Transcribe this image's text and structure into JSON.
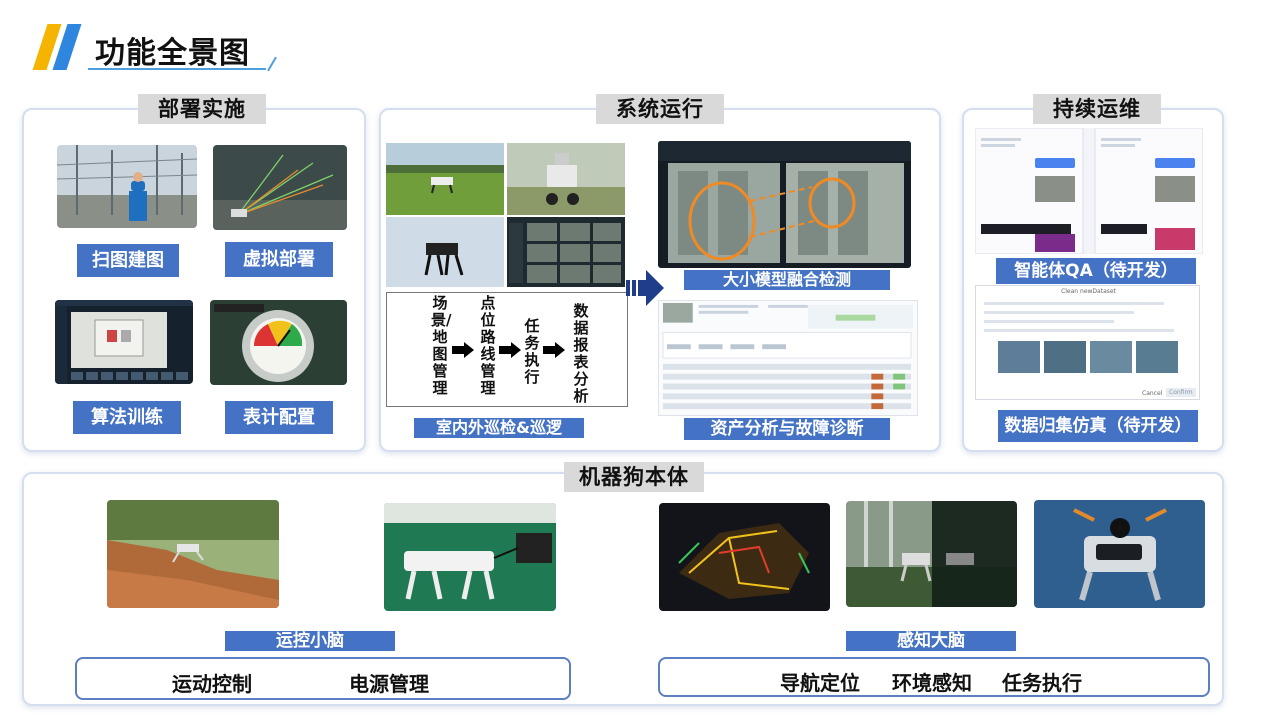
{
  "page": {
    "title": "功能全景图"
  },
  "colors": {
    "accent_blue": "#4472c4",
    "logo_yellow": "#f5b400",
    "logo_blue": "#2e86de"
  },
  "deploy": {
    "tag": "部署实施",
    "items": [
      "扫图建图",
      "虚拟部署",
      "算法训练",
      "表计配置"
    ]
  },
  "ops": {
    "tag": "系统运行",
    "process_steps": [
      "场景/地图管理",
      "点位路线管理",
      "任务执行",
      "数据报表分析"
    ],
    "patrol_label": "室内外巡检&巡逻",
    "model_label": "大小模型融合检测",
    "asset_label": "资产分析与故障诊断"
  },
  "maint": {
    "tag": "持续运维",
    "qa_label": "智能体QA（待开发）",
    "data_label": "数据归集仿真（待开发）",
    "dialog_title": "Clean newDataset",
    "dialog_cancel": "Cancel",
    "dialog_confirm": "Confirm"
  },
  "body": {
    "tag": "机器狗本体",
    "control_label": "运控小脑",
    "control_items": [
      "运动控制",
      "电源管理"
    ],
    "perception_label": "感知大脑",
    "perception_items": [
      "导航定位",
      "环境感知",
      "任务执行"
    ]
  }
}
